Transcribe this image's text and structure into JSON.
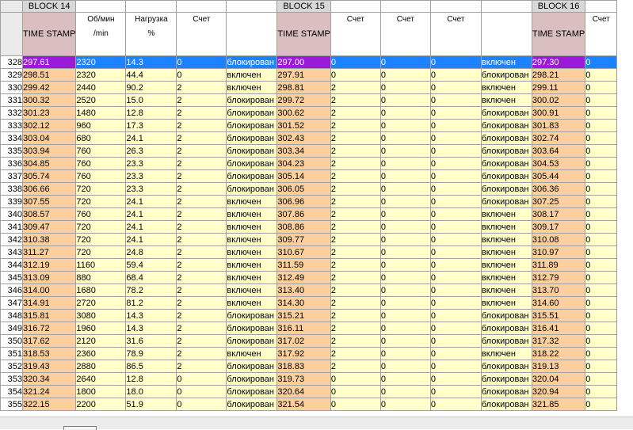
{
  "blocks": [
    "BLOCK 14",
    "BLOCK 15",
    "BLOCK 16"
  ],
  "headers": {
    "timestamp": "TIME STAMP",
    "rpm": "Об/мин",
    "rpm_unit": "/min",
    "load": "Нагрузка",
    "load_unit": "%",
    "count": "Счет"
  },
  "selected_row": "328",
  "rows": [
    {
      "n": "328",
      "t14": "297.61",
      "rpm": "2320",
      "load": "14.3",
      "cnt": "0",
      "st14": "блокирован",
      "t15": "297.00",
      "a": "0",
      "b": "0",
      "c": "0",
      "st15": "включен",
      "t16": "297.30",
      "d": "0"
    },
    {
      "n": "329",
      "t14": "298.51",
      "rpm": "2320",
      "load": "44.4",
      "cnt": "0",
      "st14": "включен",
      "t15": "297.91",
      "a": "0",
      "b": "0",
      "c": "0",
      "st15": "блокирован",
      "t16": "298.21",
      "d": "0"
    },
    {
      "n": "330",
      "t14": "299.42",
      "rpm": "2440",
      "load": "90.2",
      "cnt": "2",
      "st14": "включен",
      "t15": "298.81",
      "a": "2",
      "b": "0",
      "c": "0",
      "st15": "включен",
      "t16": "299.11",
      "d": "0"
    },
    {
      "n": "331",
      "t14": "300.32",
      "rpm": "2520",
      "load": "15.0",
      "cnt": "2",
      "st14": "блокирован",
      "t15": "299.72",
      "a": "2",
      "b": "0",
      "c": "0",
      "st15": "включен",
      "t16": "300.02",
      "d": "0"
    },
    {
      "n": "332",
      "t14": "301.23",
      "rpm": "1480",
      "load": "12.8",
      "cnt": "2",
      "st14": "блокирован",
      "t15": "300.62",
      "a": "2",
      "b": "0",
      "c": "0",
      "st15": "блокирован",
      "t16": "300.91",
      "d": "0"
    },
    {
      "n": "333",
      "t14": "302.12",
      "rpm": "960",
      "load": "17.3",
      "cnt": "2",
      "st14": "блокирован",
      "t15": "301.52",
      "a": "2",
      "b": "0",
      "c": "0",
      "st15": "блокирован",
      "t16": "301.83",
      "d": "0"
    },
    {
      "n": "334",
      "t14": "303.04",
      "rpm": "680",
      "load": "24.1",
      "cnt": "2",
      "st14": "блокирован",
      "t15": "302.43",
      "a": "2",
      "b": "0",
      "c": "0",
      "st15": "блокирован",
      "t16": "302.74",
      "d": "0"
    },
    {
      "n": "335",
      "t14": "303.94",
      "rpm": "760",
      "load": "26.3",
      "cnt": "2",
      "st14": "блокирован",
      "t15": "303.34",
      "a": "2",
      "b": "0",
      "c": "0",
      "st15": "блокирован",
      "t16": "303.64",
      "d": "0"
    },
    {
      "n": "336",
      "t14": "304.85",
      "rpm": "760",
      "load": "23.3",
      "cnt": "2",
      "st14": "блокирован",
      "t15": "304.23",
      "a": "2",
      "b": "0",
      "c": "0",
      "st15": "блокирован",
      "t16": "304.53",
      "d": "0"
    },
    {
      "n": "337",
      "t14": "305.74",
      "rpm": "760",
      "load": "23.3",
      "cnt": "2",
      "st14": "блокирован",
      "t15": "305.14",
      "a": "2",
      "b": "0",
      "c": "0",
      "st15": "блокирован",
      "t16": "305.44",
      "d": "0"
    },
    {
      "n": "338",
      "t14": "306.66",
      "rpm": "720",
      "load": "23.3",
      "cnt": "2",
      "st14": "блокирован",
      "t15": "306.05",
      "a": "2",
      "b": "0",
      "c": "0",
      "st15": "блокирован",
      "t16": "306.36",
      "d": "0"
    },
    {
      "n": "339",
      "t14": "307.55",
      "rpm": "720",
      "load": "24.1",
      "cnt": "2",
      "st14": "включен",
      "t15": "306.96",
      "a": "2",
      "b": "0",
      "c": "0",
      "st15": "блокирован",
      "t16": "307.25",
      "d": "0"
    },
    {
      "n": "340",
      "t14": "308.57",
      "rpm": "760",
      "load": "24.1",
      "cnt": "2",
      "st14": "включен",
      "t15": "307.86",
      "a": "2",
      "b": "0",
      "c": "0",
      "st15": "включен",
      "t16": "308.17",
      "d": "0"
    },
    {
      "n": "341",
      "t14": "309.47",
      "rpm": "720",
      "load": "24.1",
      "cnt": "2",
      "st14": "включен",
      "t15": "308.86",
      "a": "2",
      "b": "0",
      "c": "0",
      "st15": "включен",
      "t16": "309.17",
      "d": "0"
    },
    {
      "n": "342",
      "t14": "310.38",
      "rpm": "720",
      "load": "24.1",
      "cnt": "2",
      "st14": "включен",
      "t15": "309.77",
      "a": "2",
      "b": "0",
      "c": "0",
      "st15": "включен",
      "t16": "310.08",
      "d": "0"
    },
    {
      "n": "343",
      "t14": "311.27",
      "rpm": "720",
      "load": "24.8",
      "cnt": "2",
      "st14": "включен",
      "t15": "310.67",
      "a": "2",
      "b": "0",
      "c": "0",
      "st15": "включен",
      "t16": "310.97",
      "d": "0"
    },
    {
      "n": "344",
      "t14": "312.19",
      "rpm": "1160",
      "load": "59.4",
      "cnt": "2",
      "st14": "включен",
      "t15": "311.59",
      "a": "2",
      "b": "0",
      "c": "0",
      "st15": "включен",
      "t16": "311.89",
      "d": "0"
    },
    {
      "n": "345",
      "t14": "313.09",
      "rpm": "880",
      "load": "68.4",
      "cnt": "2",
      "st14": "включен",
      "t15": "312.49",
      "a": "2",
      "b": "0",
      "c": "0",
      "st15": "включен",
      "t16": "312.79",
      "d": "0"
    },
    {
      "n": "346",
      "t14": "314.00",
      "rpm": "1680",
      "load": "78.2",
      "cnt": "2",
      "st14": "включен",
      "t15": "313.40",
      "a": "2",
      "b": "0",
      "c": "0",
      "st15": "включен",
      "t16": "313.70",
      "d": "0"
    },
    {
      "n": "347",
      "t14": "314.91",
      "rpm": "2720",
      "load": "81.2",
      "cnt": "2",
      "st14": "включен",
      "t15": "314.30",
      "a": "2",
      "b": "0",
      "c": "0",
      "st15": "включен",
      "t16": "314.60",
      "d": "0"
    },
    {
      "n": "348",
      "t14": "315.81",
      "rpm": "3080",
      "load": "14.3",
      "cnt": "2",
      "st14": "блокирован",
      "t15": "315.21",
      "a": "2",
      "b": "0",
      "c": "0",
      "st15": "блокирован",
      "t16": "315.51",
      "d": "0"
    },
    {
      "n": "349",
      "t14": "316.72",
      "rpm": "1960",
      "load": "14.3",
      "cnt": "2",
      "st14": "блокирован",
      "t15": "316.11",
      "a": "2",
      "b": "0",
      "c": "0",
      "st15": "блокирован",
      "t16": "316.41",
      "d": "0"
    },
    {
      "n": "350",
      "t14": "317.62",
      "rpm": "2120",
      "load": "31.6",
      "cnt": "2",
      "st14": "блокирован",
      "t15": "317.02",
      "a": "2",
      "b": "0",
      "c": "0",
      "st15": "блокирован",
      "t16": "317.32",
      "d": "0"
    },
    {
      "n": "351",
      "t14": "318.53",
      "rpm": "2360",
      "load": "78.9",
      "cnt": "2",
      "st14": "включен",
      "t15": "317.92",
      "a": "2",
      "b": "0",
      "c": "0",
      "st15": "включен",
      "t16": "318.22",
      "d": "0"
    },
    {
      "n": "352",
      "t14": "319.43",
      "rpm": "2880",
      "load": "86.5",
      "cnt": "2",
      "st14": "блокирован",
      "t15": "318.83",
      "a": "2",
      "b": "0",
      "c": "0",
      "st15": "блокирован",
      "t16": "319.13",
      "d": "0"
    },
    {
      "n": "353",
      "t14": "320.34",
      "rpm": "2640",
      "load": "12.8",
      "cnt": "0",
      "st14": "блокирован",
      "t15": "319.73",
      "a": "0",
      "b": "0",
      "c": "0",
      "st15": "блокирован",
      "t16": "320.04",
      "d": "0"
    },
    {
      "n": "354",
      "t14": "321.24",
      "rpm": "1800",
      "load": "18.0",
      "cnt": "0",
      "st14": "блокирован",
      "t15": "320.64",
      "a": "0",
      "b": "0",
      "c": "0",
      "st15": "блокирован",
      "t16": "320.94",
      "d": "0"
    },
    {
      "n": "355",
      "t14": "322.15",
      "rpm": "2200",
      "load": "51.9",
      "cnt": "0",
      "st14": "блокирован",
      "t15": "321.54",
      "a": "0",
      "b": "0",
      "c": "0",
      "st15": "блокирован",
      "t16": "321.85",
      "d": "0"
    }
  ],
  "colors": {
    "timestamp_cell": "#fbcf9e",
    "data_cell": "#ffffcc",
    "selection": "#1c82ff",
    "selection_timestamp": "#9b1ad9",
    "timestamp_header": "#d9bfbf"
  }
}
